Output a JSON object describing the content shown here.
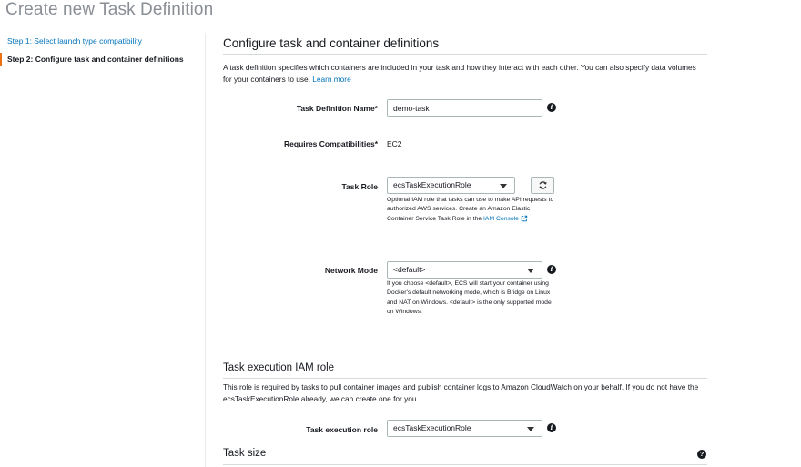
{
  "page": {
    "title": "Create new Task Definition"
  },
  "steps": {
    "step1": "Step 1: Select launch type compatibility",
    "step2": "Step 2: Configure task and container definitions"
  },
  "configure": {
    "title": "Configure task and container definitions",
    "description": "A task definition specifies which containers are included in your task and how they interact with each other. You can also specify data volumes for your containers to use.",
    "learn_more": "Learn more"
  },
  "form": {
    "task_definition_name": {
      "label": "Task Definition Name*",
      "value": "demo-task",
      "info_icon": "info-icon"
    },
    "requires_compatibilities": {
      "label": "Requires Compatibilities*",
      "value": "EC2"
    },
    "task_role": {
      "label": "Task Role",
      "selected": "ecsTaskExecutionRole",
      "help": "Optional IAM role that tasks can use to make API requests to authorized AWS services. Create an Amazon Elastic Container Service Task Role in the",
      "help_link": "IAM Console",
      "refresh_icon": "refresh-icon"
    },
    "network_mode": {
      "label": "Network Mode",
      "selected": "<default>",
      "help": "If you choose <default>, ECS will start your container using Docker's default networking mode, which is Bridge on Linux and NAT on Windows. <default> is the only supported mode on Windows.",
      "info_icon": "info-icon"
    }
  },
  "execution_role_section": {
    "title": "Task execution IAM role",
    "description": "This role is required by tasks to pull container images and publish container logs to Amazon CloudWatch on your behalf. If you do not have the ecsTaskExecutionRole already, we can create one for you.",
    "field_label": "Task execution role",
    "selected": "ecsTaskExecutionRole"
  },
  "task_size": {
    "title": "Task size",
    "help_icon": "help-icon"
  },
  "colors": {
    "link": "#0073bb",
    "accent": "#ec7211",
    "text": "#16191f",
    "muted": "#8a8f96"
  }
}
